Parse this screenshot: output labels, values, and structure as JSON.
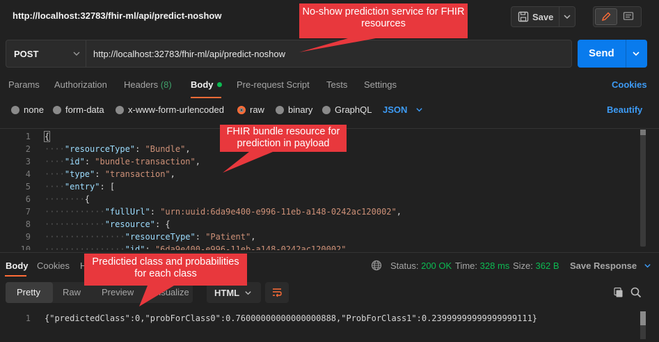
{
  "header": {
    "title": "http://localhost:32783/fhir-ml/api/predict-noshow",
    "save_label": "Save"
  },
  "request": {
    "method": "POST",
    "url": "http://localhost:32783/fhir-ml/api/predict-noshow",
    "send_label": "Send"
  },
  "tabs": {
    "params": "Params",
    "authorization": "Authorization",
    "headers": "Headers",
    "headers_count": "(8)",
    "body": "Body",
    "prerequest": "Pre-request Script",
    "tests": "Tests",
    "settings": "Settings",
    "cookies": "Cookies"
  },
  "body_types": {
    "none": "none",
    "form_data": "form-data",
    "urlencoded": "x-www-form-urlencoded",
    "raw": "raw",
    "binary": "binary",
    "graphql": "GraphQL",
    "json": "JSON",
    "beautify": "Beautify",
    "selected": "raw"
  },
  "editor": {
    "line_numbers": [
      "1",
      "2",
      "3",
      "4",
      "5",
      "6",
      "7",
      "8",
      "9",
      "10"
    ]
  },
  "response": {
    "tabs": {
      "body": "Body",
      "cookies": "Cookies",
      "headers_partial": "H"
    },
    "status_label": "Status:",
    "status_value": "200 OK",
    "time_label": "Time:",
    "time_value": "328 ms",
    "size_label": "Size:",
    "size_value": "362 B",
    "save_response": "Save Response",
    "view_tabs": {
      "pretty": "Pretty",
      "raw": "Raw",
      "preview": "Preview",
      "visualize": "Visualize"
    },
    "format": "HTML",
    "line_number": "1",
    "content": "{\"predictedClass\":0,\"probForClass0\":0.76000000000000000888,\"ProbForClass1\":0.23999999999999999111}"
  },
  "callouts": {
    "service": "No-show prediction service for FHIR resources",
    "payload": "FHIR bundle resource for prediction in payload",
    "result": "Predictied class and probabilities for each class"
  },
  "colors": {
    "accent": "#ff6c37",
    "send": "#097bed",
    "status_ok": "#0cbb52",
    "callout": "#e8383d"
  }
}
